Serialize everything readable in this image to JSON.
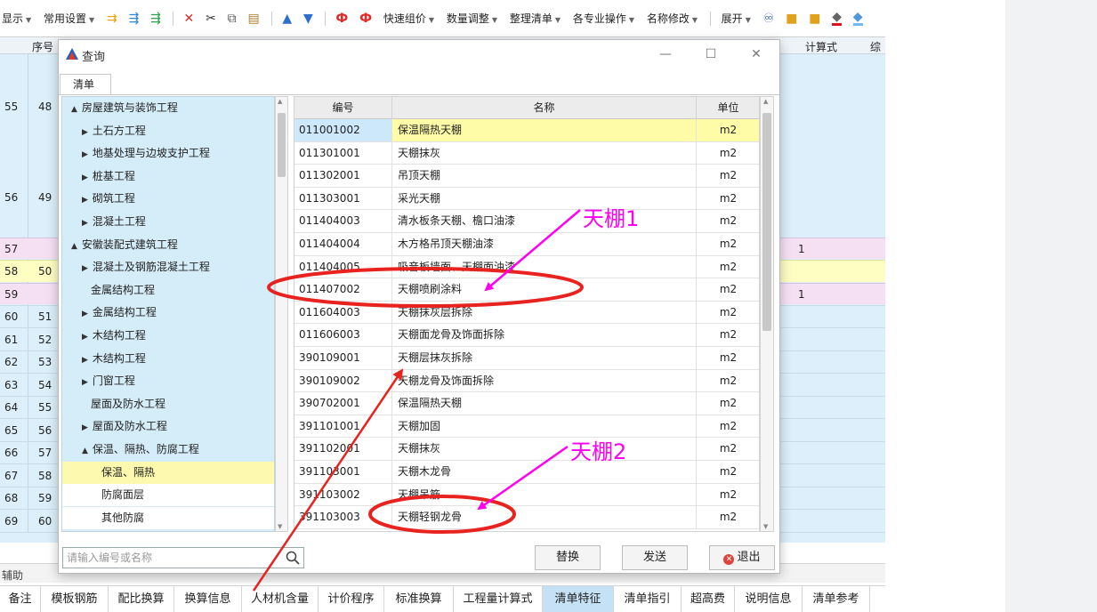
{
  "toolbar": {
    "items": [
      "显示",
      "常用设置",
      "快速组价",
      "数量调整",
      "整理清单",
      "各专业操作",
      "名称修改",
      "展开"
    ]
  },
  "grid": {
    "headers": [
      "序号",
      "计算式",
      "综"
    ],
    "line_numbers": [
      "55",
      "56",
      "57",
      "58",
      "59",
      "60",
      "61",
      "62",
      "63",
      "64",
      "65",
      "66",
      "67",
      "68",
      "69"
    ],
    "seq_numbers": [
      "48",
      "49",
      "50",
      "51",
      "52",
      "53",
      "54",
      "55",
      "56",
      "57",
      "58",
      "59",
      "60"
    ],
    "calc_values": [
      "1",
      "1"
    ]
  },
  "dialog": {
    "title": "查询",
    "tab": "清单",
    "tree": [
      {
        "label": "房屋建筑与装饰工程",
        "arrow": "▲"
      },
      {
        "label": "土石方工程",
        "arrow": "▶"
      },
      {
        "label": "地基处理与边坡支护工程",
        "arrow": "▶"
      },
      {
        "label": "桩基工程",
        "arrow": "▶"
      },
      {
        "label": "砌筑工程",
        "arrow": "▶"
      },
      {
        "label": "混凝土工程",
        "arrow": "▶"
      },
      {
        "label": "安徽装配式建筑工程",
        "arrow": "▲"
      },
      {
        "label": "混凝土及钢筋混凝土工程",
        "arrow": "▶"
      },
      {
        "label": "金属结构工程",
        "arrow": ""
      },
      {
        "label": "金属结构工程",
        "arrow": "▶"
      },
      {
        "label": "木结构工程",
        "arrow": "▶"
      },
      {
        "label": "木结构工程",
        "arrow": "▶"
      },
      {
        "label": "门窗工程",
        "arrow": "▶"
      },
      {
        "label": "屋面及防水工程",
        "arrow": ""
      },
      {
        "label": "屋面及防水工程",
        "arrow": "▶"
      },
      {
        "label": "保温、隔热、防腐工程",
        "arrow": "▲"
      },
      {
        "label": "保温、隔热",
        "arrow": ""
      },
      {
        "label": "防腐面层",
        "arrow": ""
      },
      {
        "label": "其他防腐",
        "arrow": ""
      }
    ],
    "table": {
      "headers": [
        "编号",
        "名称",
        "单位"
      ],
      "rows": [
        [
          "011001002",
          "保温隔热天棚",
          "m2"
        ],
        [
          "011301001",
          "天棚抹灰",
          "m2"
        ],
        [
          "011302001",
          "吊顶天棚",
          "m2"
        ],
        [
          "011303001",
          "采光天棚",
          "m2"
        ],
        [
          "011404003",
          "清水板条天棚、檐口油漆",
          "m2"
        ],
        [
          "011404004",
          "木方格吊顶天棚油漆",
          "m2"
        ],
        [
          "011404005",
          "吸音板墙面、天棚面油漆",
          "m2"
        ],
        [
          "011407002",
          "天棚喷刷涂料",
          "m2"
        ],
        [
          "011604003",
          "天棚抹灰层拆除",
          "m2"
        ],
        [
          "011606003",
          "天棚面龙骨及饰面拆除",
          "m2"
        ],
        [
          "390109001",
          "天棚层抹灰拆除",
          "m2"
        ],
        [
          "390109002",
          "天棚龙骨及饰面拆除",
          "m2"
        ],
        [
          "390702001",
          "保温隔热天棚",
          "m2"
        ],
        [
          "391101001",
          "天棚加固",
          "m2"
        ],
        [
          "391102001",
          "天棚抹灰",
          "m2"
        ],
        [
          "391103001",
          "天棚木龙骨",
          "m2"
        ],
        [
          "391103002",
          "天棚吊筋",
          "m2"
        ],
        [
          "391103003",
          "天棚轻钢龙骨",
          "m2"
        ]
      ]
    },
    "search_placeholder": "请输入编号或名称",
    "buttons": {
      "replace": "替换",
      "send": "发送",
      "exit": "退出"
    }
  },
  "status": {
    "label": "辅助"
  },
  "bottom_tabs": [
    "备注",
    "模板钢筋",
    "配比换算",
    "换算信息",
    "人材机含量",
    "计价程序",
    "标准换算",
    "工程量计算式",
    "清单特征",
    "清单指引",
    "超高费",
    "说明信息",
    "清单参考"
  ],
  "annotations": {
    "label1": "天棚1",
    "label2": "天棚2"
  },
  "colors": {
    "accent_tab": "#c5e1f5",
    "highlight": "#fffca8",
    "annotation_red": "#e8231f",
    "annotation_magenta": "#ff00ee"
  }
}
